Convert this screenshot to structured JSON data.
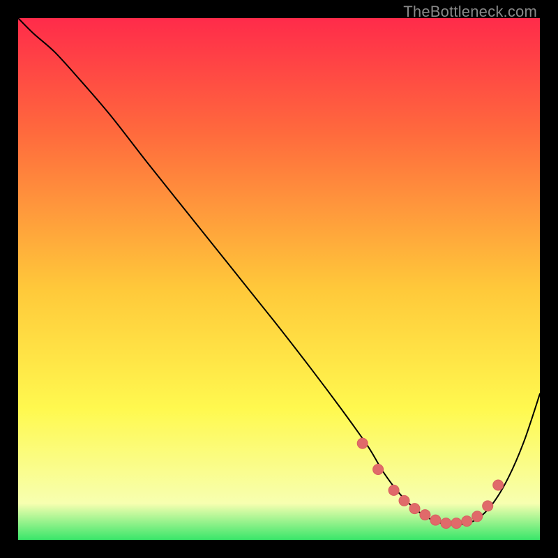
{
  "watermark": "TheBottleneck.com",
  "colors": {
    "bg": "#000000",
    "grad_top": "#ff2b4a",
    "grad_mid1": "#ff6a3d",
    "grad_mid2": "#ffc93a",
    "grad_mid3": "#fff94f",
    "grad_bottom1": "#f7ffb0",
    "grad_bottom2": "#39e66a",
    "curve": "#000000",
    "marker_fill": "#e06a6a",
    "marker_stroke": "#d85f5f"
  },
  "chart_data": {
    "type": "line",
    "title": "",
    "xlabel": "",
    "ylabel": "",
    "xlim": [
      0,
      100
    ],
    "ylim": [
      0,
      100
    ],
    "grid": false,
    "legend": false,
    "series": [
      {
        "name": "bottleneck-curve",
        "x": [
          0,
          3,
          7,
          12,
          18,
          25,
          33,
          41,
          49,
          56,
          62,
          67,
          70,
          73,
          76,
          79,
          82,
          85,
          88,
          91,
          94,
          97,
          100
        ],
        "y": [
          100,
          97,
          93.5,
          88,
          81,
          72,
          62,
          52,
          42,
          33,
          25,
          18,
          13,
          9,
          6,
          4,
          3,
          3,
          4,
          7,
          12,
          19,
          28
        ]
      }
    ],
    "markers": {
      "name": "highlighted-valley",
      "x": [
        66,
        69,
        72,
        74,
        76,
        78,
        80,
        82,
        84,
        86,
        88,
        90,
        92
      ],
      "y": [
        18.5,
        13.5,
        9.5,
        7.5,
        6,
        4.8,
        3.8,
        3.2,
        3.2,
        3.6,
        4.5,
        6.5,
        10.5
      ]
    }
  }
}
